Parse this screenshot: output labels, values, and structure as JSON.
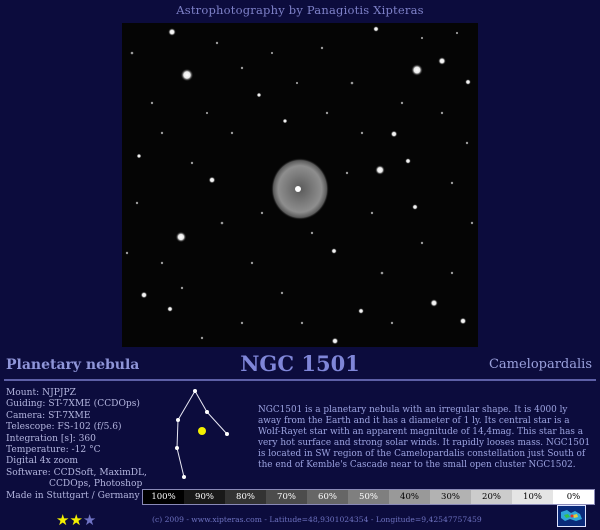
{
  "header": {
    "title": "Astrophotography by Panagiotis Xipteras"
  },
  "object": {
    "type": "Planetary nebula",
    "name": "NGC 1501",
    "constellation": "Camelopardalis"
  },
  "specs": [
    "Mount: NJPJPZ",
    "Guiding: ST-7XME (CCDOps)",
    "Camera: ST-7XME",
    "Telescope: FS-102 (f/5.6)",
    "Integration [s]: 360",
    "Temperature: -12 °C",
    "Digital 4x zoom",
    "Software: CCDSoft, MaximDL,",
    "CCDOps, Photoshop",
    "Made in Stuttgart / Germany"
  ],
  "description": "NGC1501 is a planetary nebula with an irregular shape. It is 4000 ly away from the Earth and it has a diameter of 1 ly. Its central star is a Wolf-Rayet star with an apparent magnitude of 14,4mag. This star has a very hot surface and strong solar winds. It rapidly looses mass. NGC1501 is located in SW region of the Camelopardalis constellation just South of the end of Kemble's Cascade near to the small open cluster NGC1502.",
  "scale": [
    "100%",
    "90%",
    "80%",
    "70%",
    "60%",
    "50%",
    "40%",
    "30%",
    "20%",
    "10%",
    "0%"
  ],
  "rating": {
    "value": 2,
    "max": 3
  },
  "footer": "(c) 2009 - www.xipteras.com - Latitude=48,9301024354 - Longitude=9,42547757459",
  "colors": {
    "background": "#0c0c3d",
    "heading": "#7f86d8",
    "star_on": "#f4f000",
    "star_off": "#6f73c4",
    "target_marker": "#f4f000"
  }
}
